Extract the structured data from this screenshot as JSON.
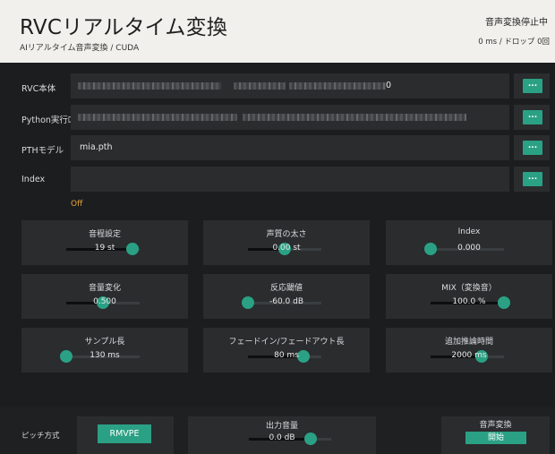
{
  "header": {
    "title": "RVCリアルタイム変換",
    "subtitle": "AIリアルタイム音声変換 / CUDA",
    "status": "音声変換停止中",
    "latency": "0 ms / ドロップ 0回"
  },
  "paths": [
    {
      "label": "RVC本体",
      "value": "0",
      "button": "..."
    },
    {
      "label": "Python実行ﾛ",
      "value": "",
      "button": "..."
    },
    {
      "label": "PTHモデル",
      "value": "mia.pth",
      "button": "..."
    },
    {
      "label": "Index",
      "value": "",
      "button": "..."
    }
  ],
  "index_status": "Off",
  "sliders": [
    {
      "label": "音程設定",
      "value": "19 st",
      "fraction": 0.9
    },
    {
      "label": "声質の太さ",
      "value": "0.00 st",
      "fraction": 0.5
    },
    {
      "label": "Index",
      "value": "0.000",
      "fraction": 0.0
    },
    {
      "label": "音量変化",
      "value": "0.500",
      "fraction": 0.5
    },
    {
      "label": "反応閾値",
      "value": "-60.0 dB",
      "fraction": 0.0
    },
    {
      "label": "MIX（変換音）",
      "value": "100.0 %",
      "fraction": 1.0
    },
    {
      "label": "サンプル長",
      "value": "130 ms",
      "fraction": 0.0
    },
    {
      "label": "フェードイン/フェードアウト長",
      "value": "80 ms",
      "fraction": 0.75
    },
    {
      "label": "追加推論時間",
      "value": "2000 ms",
      "fraction": 0.7
    }
  ],
  "bottom": {
    "pitch_label": "ピッチ方式",
    "pitch_method": "RMVPE",
    "volume_label": "出力音量",
    "volume_value": "0.0 dB",
    "volume_fraction": 0.75,
    "convert_label": "音声変換",
    "start_button": "開始"
  },
  "colors": {
    "accent": "#2aa184",
    "warning": "#e7a43a",
    "panel": "#2a2c2e",
    "background": "#1b1d1f",
    "header": "#f1f0ec"
  }
}
